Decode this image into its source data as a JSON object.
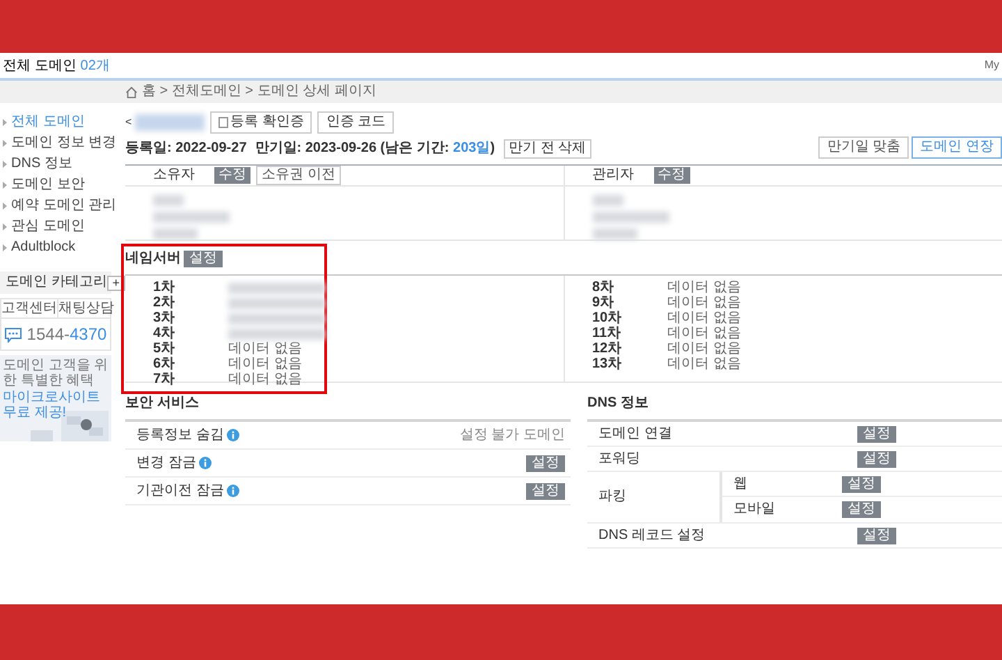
{
  "header": {
    "title": "전체 도메인",
    "count": "02개",
    "user_link": "My"
  },
  "breadcrumb": "홈 > 전체도메인 > 도메인 상세 페이지",
  "sidebar": {
    "items": [
      {
        "label": "전체 도메인",
        "selected": true
      },
      {
        "label": "도메인 정보 변경",
        "selected": false
      },
      {
        "label": "DNS 정보",
        "selected": false
      },
      {
        "label": "도메인 보안",
        "selected": false
      },
      {
        "label": "예약 도메인 관리",
        "selected": false
      },
      {
        "label": "관심 도메인",
        "selected": false
      },
      {
        "label": "Adultblock",
        "selected": false
      }
    ],
    "category": {
      "label": "도메인 카테고리",
      "add": "+"
    },
    "support_tabs": [
      "고객센터",
      "채팅상담"
    ],
    "phone_area": "1544-",
    "phone_number": "4370",
    "banner": {
      "caption": "도메인 고객을 위한 특별한 혜택",
      "headline": "마이크로사이트 무료 제공!"
    }
  },
  "domain": {
    "back": "<",
    "buttons": [
      "등록 확인증",
      "인증 코드"
    ],
    "registered": "등록일: 2022-09-27",
    "expiry_prefix": "만기일: 2023-09-26 (남은 기간:",
    "remaining_days": "203일",
    "expiry_suffix": ")",
    "delete_button": "만기 전 삭제",
    "actions": [
      {
        "label": "만기일 맞춤",
        "primary": false
      },
      {
        "label": "도메인 연장",
        "primary": true
      }
    ]
  },
  "contacts": [
    {
      "role": "소유자",
      "buttons": [
        {
          "label": "수정",
          "kind": "filled"
        },
        {
          "label": "소유권 이전",
          "kind": "outline"
        }
      ]
    },
    {
      "role": "관리자",
      "buttons": [
        {
          "label": "수정",
          "kind": "filled"
        }
      ]
    }
  ],
  "nameservers": {
    "title": "네임서버",
    "button": "설정",
    "left": [
      {
        "label": "1차",
        "kind": "blurred"
      },
      {
        "label": "2차",
        "kind": "blurred"
      },
      {
        "label": "3차",
        "kind": "blurred"
      },
      {
        "label": "4차",
        "kind": "blurred"
      },
      {
        "label": "5차",
        "kind": "text",
        "value": "데이터 없음"
      },
      {
        "label": "6차",
        "kind": "text",
        "value": "데이터 없음"
      },
      {
        "label": "7차",
        "kind": "text",
        "value": "데이터 없음"
      }
    ],
    "right": [
      {
        "label": "8차",
        "kind": "text",
        "value": "데이터 없음"
      },
      {
        "label": "9차",
        "kind": "text",
        "value": "데이터 없음"
      },
      {
        "label": "10차",
        "kind": "text",
        "value": "데이터 없음"
      },
      {
        "label": "11차",
        "kind": "text",
        "value": "데이터 없음"
      },
      {
        "label": "12차",
        "kind": "text",
        "value": "데이터 없음"
      },
      {
        "label": "13차",
        "kind": "text",
        "value": "데이터 없음"
      }
    ]
  },
  "security": {
    "title": "보안 서비스",
    "rows": [
      {
        "label": "등록정보 숨김",
        "kind": "note",
        "note": "설정 불가 도메인"
      },
      {
        "label": "변경 잠금",
        "kind": "button",
        "button": "설정"
      },
      {
        "label": "기관이전 잠금",
        "kind": "button",
        "button": "설정"
      }
    ]
  },
  "dns": {
    "title": "DNS 정보",
    "rows": [
      {
        "label": "도메인 연결",
        "button": "설정"
      },
      {
        "label": "포워딩",
        "button": "설정"
      },
      {
        "label": "파킹",
        "children": [
          {
            "label": "웹",
            "button": "설정"
          },
          {
            "label": "모바일",
            "button": "설정"
          }
        ]
      },
      {
        "label": "DNS 레코드 설정",
        "button": "설정"
      }
    ]
  }
}
